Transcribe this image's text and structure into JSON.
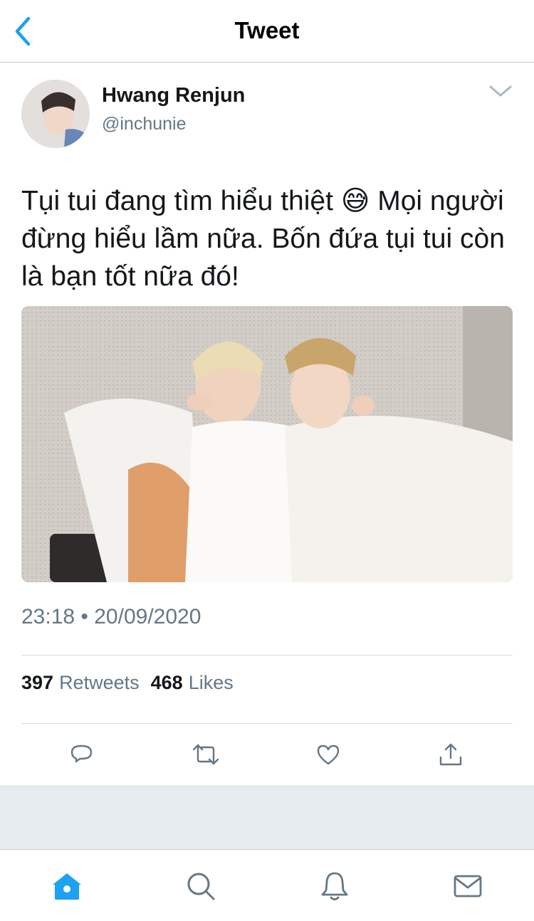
{
  "nav": {
    "title": "Tweet",
    "back_icon": "chevron-left-icon"
  },
  "tweet": {
    "author": {
      "name": "Hwang Renjun",
      "handle": "@inchunie"
    },
    "text": "Tụi tui đang tìm hiểu thiệt 😅 Mọi người đừng hiểu lầm nữa. Bốn đứa tụi tui còn là bạn tốt nữa đó!",
    "timestamp": "23:18 • 20/09/2020",
    "stats": {
      "retweets_count": "397",
      "retweets_label": "Retweets",
      "likes_count": "468",
      "likes_label": "Likes"
    }
  },
  "actions": [
    "reply-icon",
    "retweet-icon",
    "like-icon",
    "share-icon"
  ],
  "tabs": [
    "home-icon",
    "search-icon",
    "notifications-icon",
    "messages-icon"
  ],
  "colors": {
    "accent": "#1da1f2",
    "secondary_text": "#657786",
    "primary_text": "#14171a",
    "divider": "#d5dbe0"
  }
}
